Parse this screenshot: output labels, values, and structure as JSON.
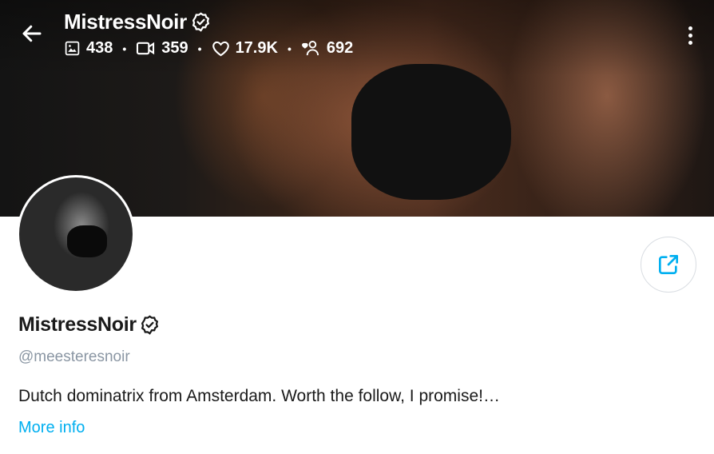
{
  "header": {
    "title": "MistressNoir",
    "stats": [
      {
        "icon": "image-icon",
        "value": "438"
      },
      {
        "icon": "video-icon",
        "value": "359"
      },
      {
        "icon": "heart-icon",
        "value": "17.9K"
      },
      {
        "icon": "fans-icon",
        "value": "692"
      }
    ]
  },
  "profile": {
    "name": "MistressNoir",
    "handle": "@meesteresnoir",
    "bio": "Dutch dominatrix from Amsterdam. Worth the follow, I promise!…",
    "more_info": "More info"
  },
  "colors": {
    "accent": "#00aff0",
    "text": "#1a1a1a",
    "muted": "#8a96a3"
  }
}
